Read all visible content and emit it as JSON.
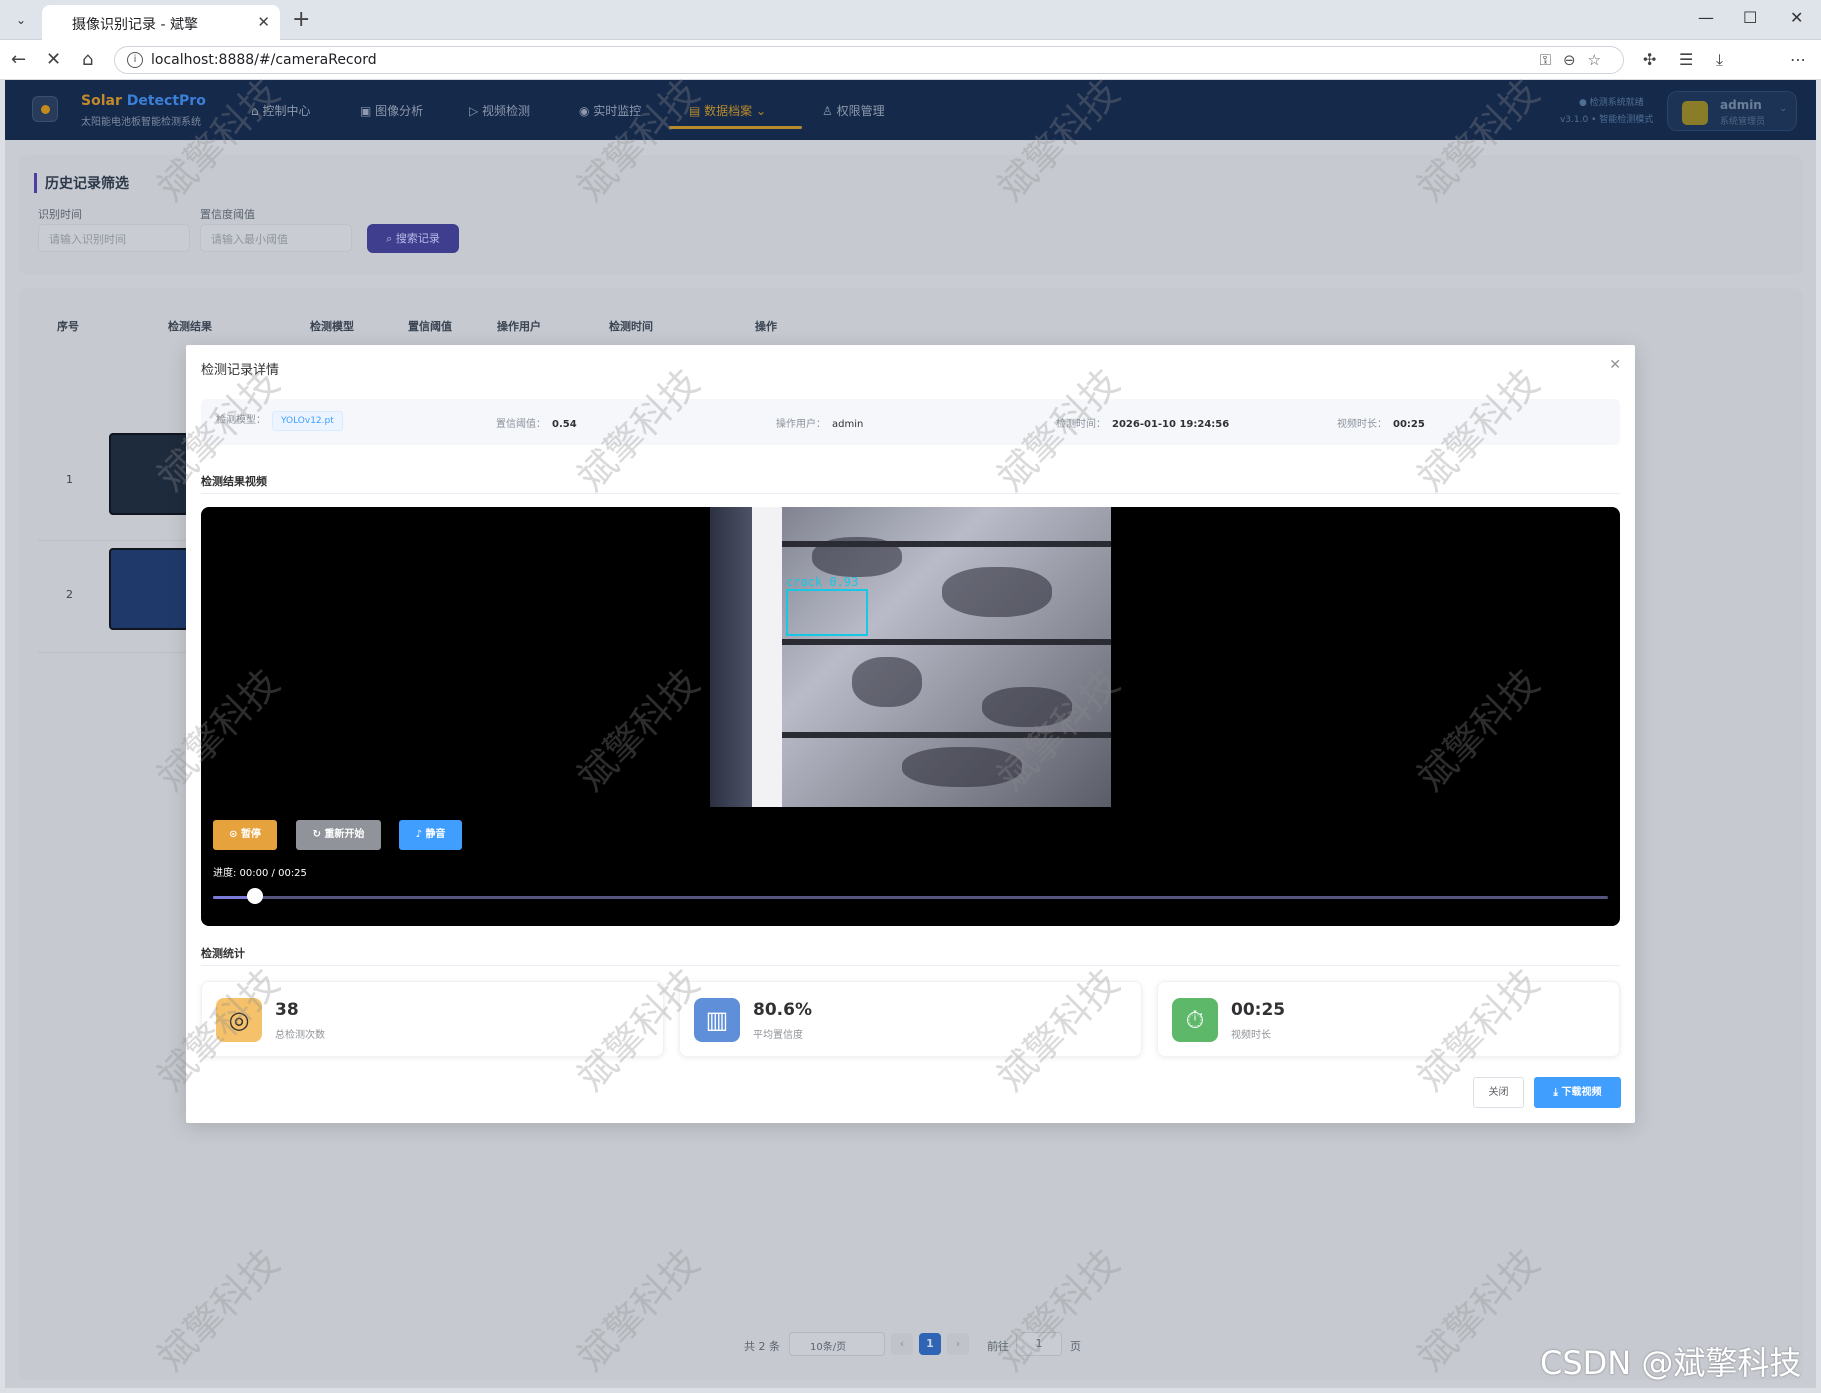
{
  "browser": {
    "tab_title": "摄像识别记录 - 斌擎",
    "url": "localhost:8888/#/cameraRecord"
  },
  "app": {
    "brand_a": "Solar",
    "brand_b": "DetectPro",
    "brand_sub": "太阳能电池板智能检测系统",
    "nav": [
      "控制中心",
      "图像分析",
      "视频检测",
      "实时监控",
      "数据档案",
      "权限管理"
    ],
    "active_nav": "数据档案",
    "status": "检测系统就绪",
    "version": "v3.1.0 • 智能检测模式",
    "user_name": "admin",
    "user_role": "系统管理员"
  },
  "filter": {
    "title": "历史记录筛选",
    "time_label": "识别时间",
    "time_placeholder": "请输入识别时间",
    "conf_label": "置信度阈值",
    "conf_placeholder": "请输入最小阈值",
    "search_button": "搜索记录"
  },
  "table": {
    "headers": [
      "序号",
      "检测结果",
      "检测模型",
      "置信阈值",
      "操作用户",
      "检测时间",
      "操作"
    ],
    "rows": [
      "1",
      "2"
    ],
    "thumb_label": "crack 0.93"
  },
  "pagination": {
    "total": "共 2 条",
    "page_size": "10条/页",
    "current": "1",
    "goto": "前往",
    "goto_value": "1",
    "page_suffix": "页"
  },
  "modal": {
    "title": "检测记录详情",
    "info": {
      "model_label": "检测模型：",
      "model_value": "YOLOv12.pt",
      "conf_label": "置信阈值：",
      "conf_value": "0.54",
      "user_label": "操作用户：",
      "user_value": "admin",
      "time_label": "检测时间：",
      "time_value": "2026-01-10 19:24:56",
      "dur_label": "视频时长：",
      "dur_value": "00:25"
    },
    "video_section": "检测结果视频",
    "detection_label": "crack  0.93",
    "buttons": {
      "pause": "暂停",
      "restart": "重新开始",
      "mute": "静音"
    },
    "progress": "进度: 00:00 / 00:25",
    "progress_fraction": 0.03,
    "stats_section": "检测统计",
    "stats": [
      {
        "value": "38",
        "label": "总检测次数",
        "icon": "target-icon"
      },
      {
        "value": "80.6%",
        "label": "平均置信度",
        "icon": "bar-chart-icon"
      },
      {
        "value": "00:25",
        "label": "视频时长",
        "icon": "stopwatch-icon"
      }
    ],
    "close_button": "关闭",
    "download_button": "下载视频"
  },
  "watermark": "斌擎科技",
  "csdn_mark": "CSDN @斌擎科技"
}
